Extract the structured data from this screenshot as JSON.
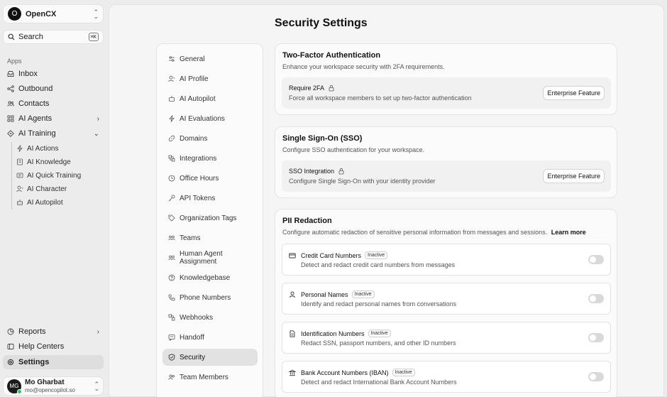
{
  "workspace": {
    "avatar": "O",
    "name": "OpenCX"
  },
  "search": {
    "label": "Search",
    "shortcut": "⌘K"
  },
  "sidebar": {
    "section_label": "Apps",
    "items": [
      {
        "label": "Inbox",
        "icon": "inbox-icon"
      },
      {
        "label": "Outbound",
        "icon": "outbound-icon"
      },
      {
        "label": "Contacts",
        "icon": "contacts-icon"
      },
      {
        "label": "AI Agents",
        "icon": "agents-icon"
      },
      {
        "label": "AI Training",
        "icon": "training-icon"
      }
    ],
    "training_children": [
      {
        "label": "AI Actions",
        "icon": "bolt-icon"
      },
      {
        "label": "AI Knowledge",
        "icon": "book-icon"
      },
      {
        "label": "AI Quick Training",
        "icon": "quick-training-icon"
      },
      {
        "label": "AI Character",
        "icon": "character-icon"
      },
      {
        "label": "AI Autopilot",
        "icon": "autopilot-icon"
      }
    ],
    "bottom_items": [
      {
        "label": "Reports",
        "icon": "reports-icon"
      },
      {
        "label": "Help Centers",
        "icon": "help-centers-icon"
      },
      {
        "label": "Settings",
        "icon": "settings-icon"
      }
    ]
  },
  "user": {
    "initials": "MG",
    "name": "Mo Gharbat",
    "email": "mo@opencopilot.so"
  },
  "page": {
    "title": "Security Settings"
  },
  "settings_nav": [
    {
      "label": "General",
      "icon": "sliders-icon"
    },
    {
      "label": "AI Profile",
      "icon": "ai-profile-icon"
    },
    {
      "label": "AI Autopilot",
      "icon": "autopilot-icon"
    },
    {
      "label": "AI Evaluations",
      "icon": "bolt-icon"
    },
    {
      "label": "Domains",
      "icon": "link-icon"
    },
    {
      "label": "Integrations",
      "icon": "integrations-icon"
    },
    {
      "label": "Office Hours",
      "icon": "clock-icon"
    },
    {
      "label": "API Tokens",
      "icon": "key-icon"
    },
    {
      "label": "Organization Tags",
      "icon": "tag-icon"
    },
    {
      "label": "Teams",
      "icon": "teams-icon"
    },
    {
      "label": "Human Agent Assignment",
      "icon": "assignment-icon"
    },
    {
      "label": "Knowledgebase",
      "icon": "help-circle-icon"
    },
    {
      "label": "Phone Numbers",
      "icon": "phone-icon"
    },
    {
      "label": "Webhooks",
      "icon": "webhooks-icon"
    },
    {
      "label": "Handoff",
      "icon": "handoff-icon"
    },
    {
      "label": "Security",
      "icon": "shield-icon"
    },
    {
      "label": "Team Members",
      "icon": "users-icon"
    }
  ],
  "two_factor": {
    "title": "Two-Factor Authentication",
    "description": "Enhance your workspace security with 2FA requirements.",
    "feature_name": "Require 2FA",
    "feature_desc": "Force all workspace members to set up two-factor authentication",
    "button": "Enterprise Feature"
  },
  "sso": {
    "title": "Single Sign-On (SSO)",
    "description": "Configure SSO authentication for your workspace.",
    "feature_name": "SSO Integration",
    "feature_desc": "Configure Single Sign-On with your identity provider",
    "button": "Enterprise Feature"
  },
  "pii": {
    "title": "PII Redaction",
    "description": "Configure automatic redaction of sensitive personal information from messages and sessions.",
    "learn_more": "Learn more",
    "items": [
      {
        "name": "Credit Card Numbers",
        "status": "Inactive",
        "desc": "Detect and redact credit card numbers from messages",
        "icon": "credit-card-icon",
        "enabled": false
      },
      {
        "name": "Personal Names",
        "status": "Inactive",
        "desc": "Identify and redact personal names from conversations",
        "icon": "person-icon",
        "enabled": false
      },
      {
        "name": "Identification Numbers",
        "status": "Inactive",
        "desc": "Redact SSN, passport numbers, and other ID numbers",
        "icon": "document-icon",
        "enabled": false
      },
      {
        "name": "Bank Account Numbers (IBAN)",
        "status": "Inactive",
        "desc": "Detect and redact International Bank Account Numbers",
        "icon": "bank-icon",
        "enabled": false
      }
    ]
  }
}
